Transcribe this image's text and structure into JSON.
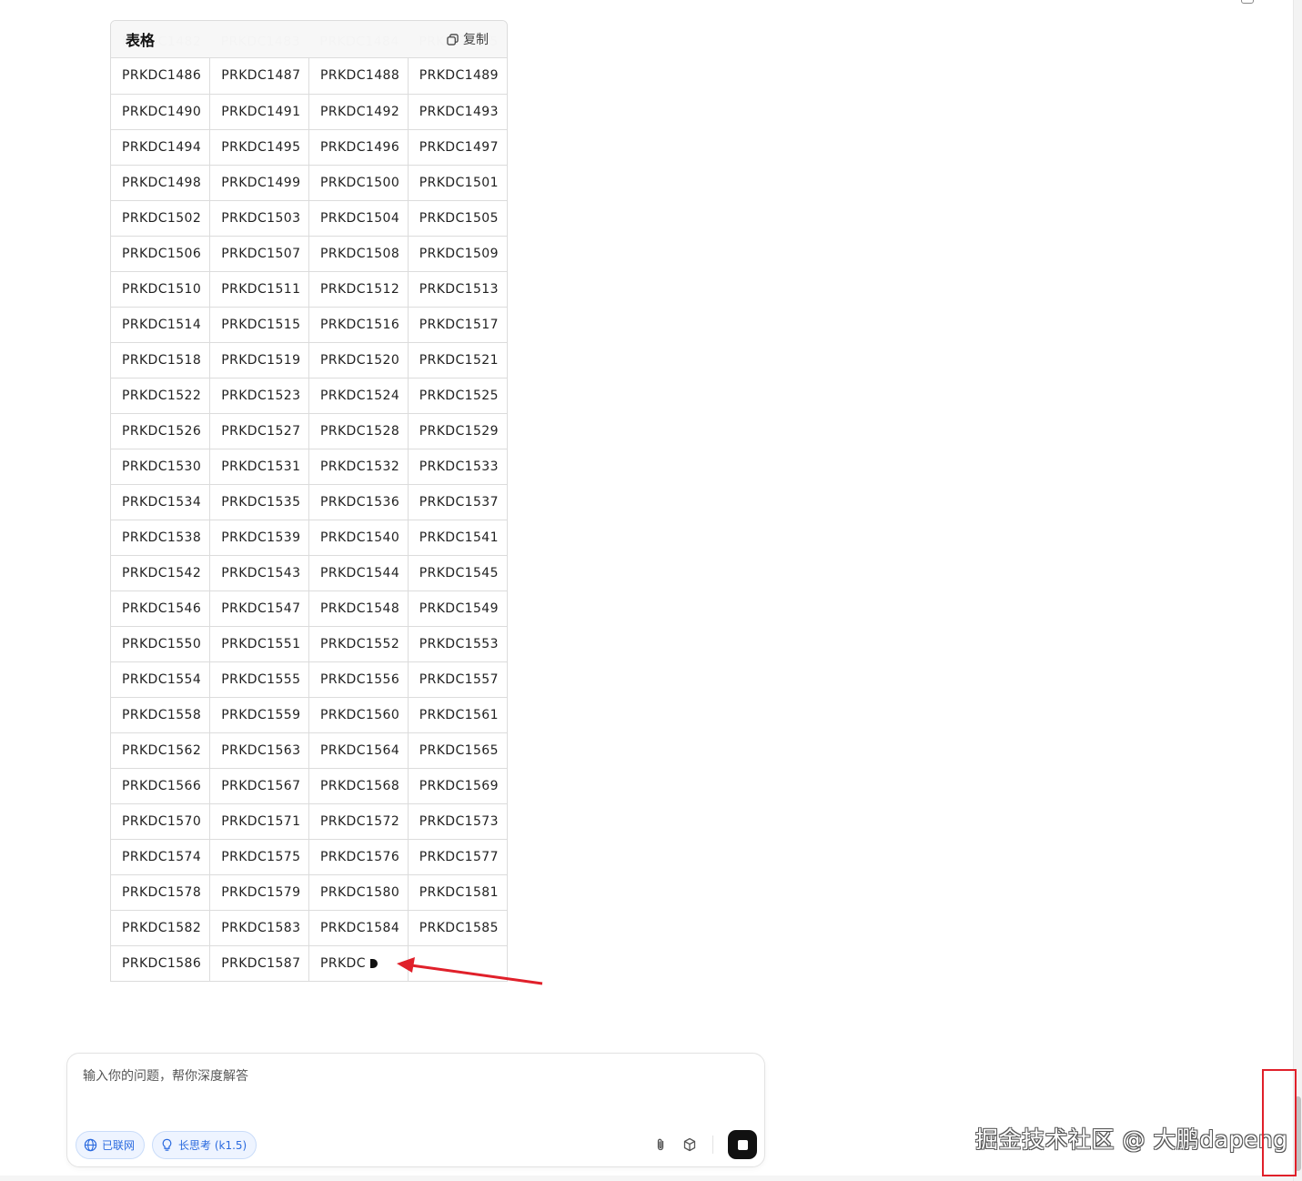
{
  "table": {
    "title": "表格",
    "copy_label": "复制",
    "ghost_header": [
      "PRKDC1482",
      "PRKDC1483",
      "PRKDC1484",
      "PRKDC1485"
    ],
    "rows": [
      [
        "PRKDC1486",
        "PRKDC1487",
        "PRKDC1488",
        "PRKDC1489"
      ],
      [
        "PRKDC1490",
        "PRKDC1491",
        "PRKDC1492",
        "PRKDC1493"
      ],
      [
        "PRKDC1494",
        "PRKDC1495",
        "PRKDC1496",
        "PRKDC1497"
      ],
      [
        "PRKDC1498",
        "PRKDC1499",
        "PRKDC1500",
        "PRKDC1501"
      ],
      [
        "PRKDC1502",
        "PRKDC1503",
        "PRKDC1504",
        "PRKDC1505"
      ],
      [
        "PRKDC1506",
        "PRKDC1507",
        "PRKDC1508",
        "PRKDC1509"
      ],
      [
        "PRKDC1510",
        "PRKDC1511",
        "PRKDC1512",
        "PRKDC1513"
      ],
      [
        "PRKDC1514",
        "PRKDC1515",
        "PRKDC1516",
        "PRKDC1517"
      ],
      [
        "PRKDC1518",
        "PRKDC1519",
        "PRKDC1520",
        "PRKDC1521"
      ],
      [
        "PRKDC1522",
        "PRKDC1523",
        "PRKDC1524",
        "PRKDC1525"
      ],
      [
        "PRKDC1526",
        "PRKDC1527",
        "PRKDC1528",
        "PRKDC1529"
      ],
      [
        "PRKDC1530",
        "PRKDC1531",
        "PRKDC1532",
        "PRKDC1533"
      ],
      [
        "PRKDC1534",
        "PRKDC1535",
        "PRKDC1536",
        "PRKDC1537"
      ],
      [
        "PRKDC1538",
        "PRKDC1539",
        "PRKDC1540",
        "PRKDC1541"
      ],
      [
        "PRKDC1542",
        "PRKDC1543",
        "PRKDC1544",
        "PRKDC1545"
      ],
      [
        "PRKDC1546",
        "PRKDC1547",
        "PRKDC1548",
        "PRKDC1549"
      ],
      [
        "PRKDC1550",
        "PRKDC1551",
        "PRKDC1552",
        "PRKDC1553"
      ],
      [
        "PRKDC1554",
        "PRKDC1555",
        "PRKDC1556",
        "PRKDC1557"
      ],
      [
        "PRKDC1558",
        "PRKDC1559",
        "PRKDC1560",
        "PRKDC1561"
      ],
      [
        "PRKDC1562",
        "PRKDC1563",
        "PRKDC1564",
        "PRKDC1565"
      ],
      [
        "PRKDC1566",
        "PRKDC1567",
        "PRKDC1568",
        "PRKDC1569"
      ],
      [
        "PRKDC1570",
        "PRKDC1571",
        "PRKDC1572",
        "PRKDC1573"
      ],
      [
        "PRKDC1574",
        "PRKDC1575",
        "PRKDC1576",
        "PRKDC1577"
      ],
      [
        "PRKDC1578",
        "PRKDC1579",
        "PRKDC1580",
        "PRKDC1581"
      ],
      [
        "PRKDC1582",
        "PRKDC1583",
        "PRKDC1584",
        "PRKDC1585"
      ]
    ],
    "partial_row": [
      "PRKDC1586",
      "PRKDC1587",
      "PRKDC"
    ]
  },
  "chat": {
    "placeholder": "输入你的问题，帮你深度解答",
    "chip_online": "已联网",
    "chip_thinking": "长思考 (k1.5)",
    "icons": [
      "globe-icon",
      "lightbulb-icon",
      "paperclip-icon",
      "cube-icon",
      "stop-icon",
      "copy-icon"
    ]
  },
  "watermark": "掘金技术社区 @ 大鹏dapeng",
  "colors": {
    "annotation_red": "#e0202a",
    "chip_blue": "#2a6adf",
    "chip_bg": "#eef4ff",
    "stop_button": "#111111"
  }
}
